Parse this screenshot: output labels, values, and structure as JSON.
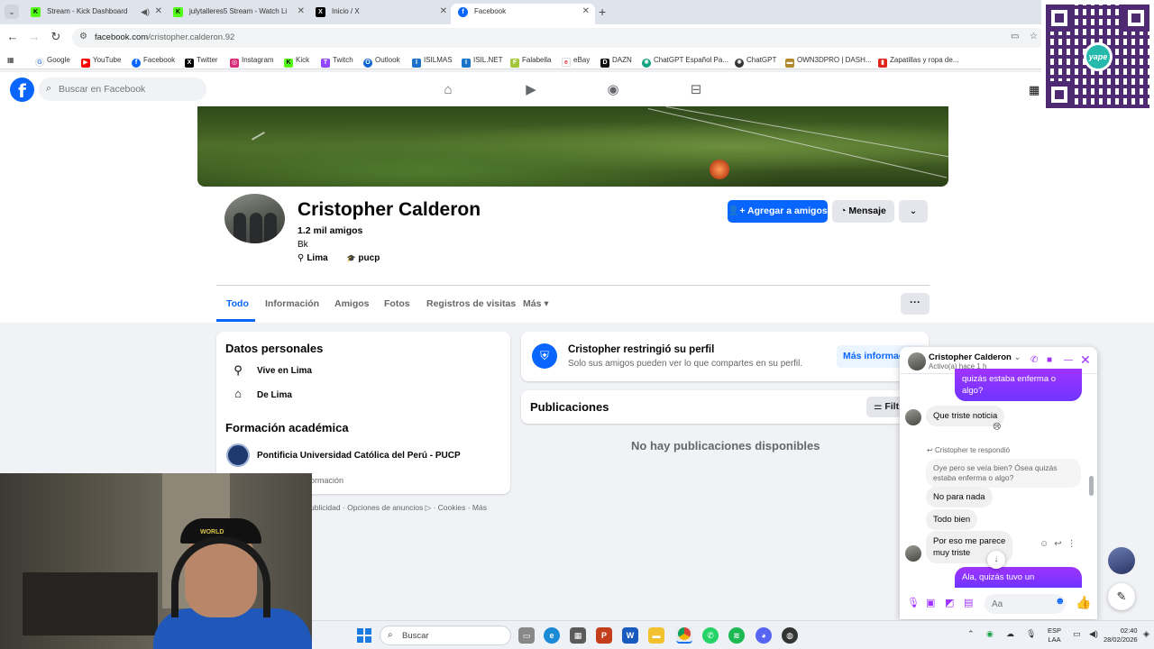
{
  "browser": {
    "tabs": [
      {
        "title": "Stream - Kick Dashboard",
        "favicon": "kick-icon"
      },
      {
        "title": "julytalleres5 Stream - Watch Li",
        "favicon": "kick-icon"
      },
      {
        "title": "Inicio / X",
        "favicon": "x-icon"
      },
      {
        "title": "Facebook",
        "favicon": "facebook-icon"
      }
    ],
    "url_domain": "facebook.com",
    "url_path": "/cristopher.calderon.92",
    "bookmarks": [
      "Google",
      "YouTube",
      "Facebook",
      "Twitter",
      "Instagram",
      "Kick",
      "Twitch",
      "Outlook",
      "ISILMAS",
      "ISIL.NET",
      "Falabella",
      "eBay",
      "DAZN",
      "ChatGPT Español Pa...",
      "ChatGPT",
      "OWN3DPRO | DASH...",
      "Zapatillas y ropa de..."
    ],
    "colors": {
      "kick": "#53fc18",
      "facebook": "#0866ff",
      "youtube": "#ff0000"
    }
  },
  "facebook": {
    "search_placeholder": "Buscar en Facebook",
    "logo_letter": "f"
  },
  "profile": {
    "name": "Cristopher Calderon",
    "friends": "1.2 mil amigos",
    "bio": "Bk",
    "location": "Lima",
    "school_short": "pucp",
    "add_friend_label": "Agregar a amigos",
    "message_label": "Mensaje",
    "tabs": [
      "Todo",
      "Información",
      "Amigos",
      "Fotos",
      "Registros de visitas",
      "Más"
    ],
    "more_caret": "▾"
  },
  "personal": {
    "heading": "Datos personales",
    "lives_in": "Vive en Lima",
    "from": "De Lima",
    "education_heading": "Formación académica",
    "university": "Pontificia Universidad Católica del Perú - PUCP",
    "info_link": "ormación"
  },
  "footer": {
    "links": "ublicidad · Opciones de anuncios ▷ · Cookies · Más"
  },
  "restricted": {
    "title": "Cristopher restringió su perfil",
    "subtitle": "Solo sus amigos pueden ver lo que compartes en su perfil.",
    "button": "Más informac"
  },
  "posts": {
    "title": "Publicaciones",
    "filter_label": "Filt",
    "empty": "No hay publicaciones disponibles"
  },
  "chat": {
    "name": "Cristopher Calderon",
    "status": "Activo(a) hace 1 h",
    "messages": [
      {
        "text_line1": "quizás estaba enferma o",
        "text_line2": "algo?"
      },
      {
        "text": "Que triste noticia"
      },
      {
        "replied": "Cristopher te respondió"
      },
      {
        "quote_line1": "Oye pero se veía bien? Ósea quizás",
        "quote_line2": "estaba enferma o algo?"
      },
      {
        "text": "No para nada"
      },
      {
        "text": "Todo bien"
      },
      {
        "text_line1": "Por eso me parece",
        "text_line2": "muy triste"
      },
      {
        "text": "Ala, quizás tuvo un"
      }
    ],
    "reaction_emoji": "😢",
    "input_placeholder": "Aa"
  },
  "qr": {
    "brand": "yape"
  },
  "webcam": {
    "cap_text": "WORLD"
  },
  "taskbar": {
    "search_label": "Buscar",
    "lang_line1": "ESP",
    "lang_line2": "LAA",
    "time": "02:40",
    "date": "28/02/2026"
  }
}
